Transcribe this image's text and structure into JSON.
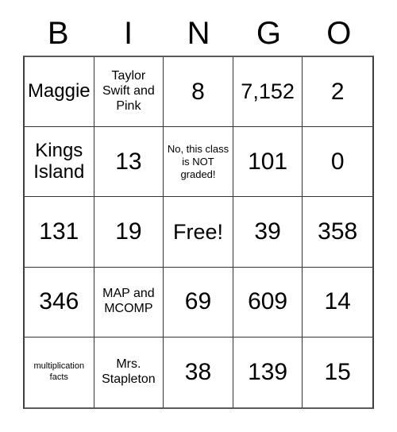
{
  "card": {
    "title": "BINGO",
    "header_letters": [
      "B",
      "I",
      "N",
      "G",
      "O"
    ],
    "free_space_label": "Free!",
    "grid_size": "5x5",
    "colors": {
      "background": "#ffffff",
      "text": "#000000",
      "grid_line": "#333333",
      "outer_border": "#404040"
    },
    "rows": [
      [
        {
          "text": "Maggie",
          "size": "size-md"
        },
        {
          "text": "Taylor Swift and Pink",
          "size": "size-sm"
        },
        {
          "text": "8",
          "size": "size-xl"
        },
        {
          "text": "7,152",
          "size": "size-lg"
        },
        {
          "text": "2",
          "size": "size-xl"
        }
      ],
      [
        {
          "text": "Kings Island",
          "size": "size-md"
        },
        {
          "text": "13",
          "size": "size-xl"
        },
        {
          "text": "No, this class is NOT graded!",
          "size": "size-xs"
        },
        {
          "text": "101",
          "size": "size-xl"
        },
        {
          "text": "0",
          "size": "size-xl"
        }
      ],
      [
        {
          "text": "131",
          "size": "size-xl"
        },
        {
          "text": "19",
          "size": "size-xl"
        },
        {
          "text": "Free!",
          "size": "size-lg"
        },
        {
          "text": "39",
          "size": "size-xl"
        },
        {
          "text": "358",
          "size": "size-xl"
        }
      ],
      [
        {
          "text": "346",
          "size": "size-xl"
        },
        {
          "text": "MAP and MCOMP",
          "size": "size-sm"
        },
        {
          "text": "69",
          "size": "size-xl"
        },
        {
          "text": "609",
          "size": "size-xl"
        },
        {
          "text": "14",
          "size": "size-xl"
        }
      ],
      [
        {
          "text": "multiplication facts",
          "size": "size-xxs"
        },
        {
          "text": "Mrs. Stapleton",
          "size": "size-sm"
        },
        {
          "text": "38",
          "size": "size-xl"
        },
        {
          "text": "139",
          "size": "size-xl"
        },
        {
          "text": "15",
          "size": "size-xl"
        }
      ]
    ]
  }
}
